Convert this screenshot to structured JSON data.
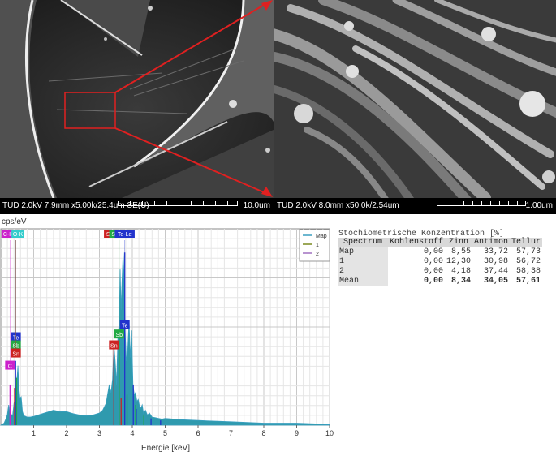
{
  "sem_images": [
    {
      "params": "TUD 2.0kV 7.9mm x5.00k/25.4um SE(U)",
      "scale_label": "10.0um"
    },
    {
      "params": "TUD 2.0kV 8.0mm x50.0k/2.54um",
      "scale_label": "1.00um"
    }
  ],
  "highlight_color": "#e02020",
  "chart_data": {
    "type": "area",
    "ylabel": "cps/eV",
    "xlabel": "Energie [keV]",
    "xlim": [
      0,
      10
    ],
    "x_ticks": [
      1,
      2,
      3,
      4,
      5,
      6,
      7,
      8,
      9,
      10
    ],
    "grid": true,
    "legend_position": "top-right",
    "series": [
      {
        "name": "Map",
        "color": "#3a9fc0",
        "fill": "#2f9aae"
      },
      {
        "name": "1",
        "color": "#7a8a20"
      },
      {
        "name": "2",
        "color": "#a070c0"
      }
    ],
    "spectrum": {
      "x": [
        0.0,
        0.1,
        0.16,
        0.2,
        0.24,
        0.27,
        0.3,
        0.33,
        0.36,
        0.4,
        0.44,
        0.48,
        0.52,
        0.55,
        0.58,
        0.62,
        0.66,
        0.7,
        0.8,
        0.9,
        1.0,
        1.2,
        1.4,
        1.6,
        1.8,
        2.0,
        2.2,
        2.4,
        2.6,
        2.8,
        3.0,
        3.1,
        3.2,
        3.3,
        3.35,
        3.4,
        3.44,
        3.48,
        3.52,
        3.56,
        3.6,
        3.63,
        3.66,
        3.69,
        3.72,
        3.75,
        3.78,
        3.82,
        3.86,
        3.9,
        3.94,
        3.98,
        4.02,
        4.06,
        4.1,
        4.14,
        4.18,
        4.22,
        4.26,
        4.3,
        4.34,
        4.4,
        4.46,
        4.52,
        4.6,
        4.7,
        4.8,
        4.9,
        5.0,
        5.5,
        6.0,
        6.5,
        7.0,
        7.5,
        8.0,
        8.5,
        9.0,
        9.5,
        10.0
      ],
      "y": [
        0,
        3,
        10,
        16,
        30,
        20,
        18,
        15,
        15,
        32,
        40,
        60,
        88,
        55,
        40,
        42,
        20,
        14,
        12,
        12,
        13,
        16,
        19,
        22,
        20,
        20,
        17,
        15,
        14,
        15,
        18,
        22,
        32,
        60,
        48,
        68,
        120,
        95,
        60,
        130,
        150,
        230,
        170,
        215,
        255,
        220,
        140,
        95,
        110,
        155,
        100,
        140,
        60,
        45,
        48,
        35,
        38,
        28,
        25,
        30,
        18,
        22,
        15,
        18,
        12,
        11,
        10,
        9,
        10,
        8,
        7,
        6,
        5,
        4,
        3,
        3,
        3,
        2,
        1
      ]
    },
    "peak_markers": [
      {
        "label": "Te",
        "color": "#2233cc",
        "x": 0.46,
        "height": 130
      },
      {
        "label": "Sb",
        "color": "#22aa44",
        "x": 0.46,
        "height": 118
      },
      {
        "label": "Sn",
        "color": "#cc2222",
        "x": 0.46,
        "height": 106
      },
      {
        "label": "C",
        "color": "#cc22cc",
        "x": 0.28,
        "height": 88
      },
      {
        "label": "Te",
        "color": "#2233cc",
        "x": 3.77,
        "height": 148
      },
      {
        "label": "Sb",
        "color": "#22aa44",
        "x": 3.6,
        "height": 134
      },
      {
        "label": "Sn",
        "color": "#cc2222",
        "x": 3.44,
        "height": 118
      }
    ],
    "top_labels": [
      {
        "text": "C-Kα",
        "color": "#cc22cc",
        "x": 0.27
      },
      {
        "text": "O-K",
        "color": "#33cccc",
        "x": 0.52
      },
      {
        "text": "Sn-Lα",
        "color": "#cc2222",
        "x": 3.44
      },
      {
        "text": "Sb-Lα",
        "color": "#22aa44",
        "x": 3.6
      },
      {
        "text": "Te-Lα",
        "color": "#2233cc",
        "x": 3.77
      }
    ],
    "lines": [
      {
        "color": "#cc22cc",
        "x": 0.28,
        "h": 60
      },
      {
        "color": "#2233cc",
        "x": 0.45,
        "h": 95
      },
      {
        "color": "#22aa44",
        "x": 0.48,
        "h": 70
      },
      {
        "color": "#cc2222",
        "x": 0.42,
        "h": 55
      },
      {
        "color": "#cc2222",
        "x": 3.44,
        "h": 120
      },
      {
        "color": "#cc2222",
        "x": 3.66,
        "h": 40
      },
      {
        "color": "#22aa44",
        "x": 3.6,
        "h": 140
      },
      {
        "color": "#22aa44",
        "x": 3.84,
        "h": 45
      },
      {
        "color": "#2233cc",
        "x": 3.77,
        "h": 255
      },
      {
        "color": "#2233cc",
        "x": 4.03,
        "h": 60
      },
      {
        "color": "#2233cc",
        "x": 4.12,
        "h": 24
      },
      {
        "color": "#22aa44",
        "x": 4.1,
        "h": 30
      },
      {
        "color": "#2233cc",
        "x": 4.57,
        "h": 10
      },
      {
        "color": "#2233cc",
        "x": 4.86,
        "h": 7
      },
      {
        "color": "#22aa44",
        "x": 4.35,
        "h": 14
      }
    ]
  },
  "quant": {
    "title": "Stöchiometrische Konzentration [%]",
    "headers": [
      "Spectrum",
      "Kohlenstoff",
      "Zinn",
      "Antimon",
      "Tellur"
    ],
    "rows": [
      [
        "Map",
        "0,00",
        "8,55",
        "33,72",
        "57,73"
      ],
      [
        "1",
        "0,00",
        "12,30",
        "30,98",
        "56,72"
      ],
      [
        "2",
        "0,00",
        "4,18",
        "37,44",
        "58,38"
      ],
      [
        "Mean",
        "0,00",
        "8,34",
        "34,05",
        "57,61"
      ]
    ]
  }
}
